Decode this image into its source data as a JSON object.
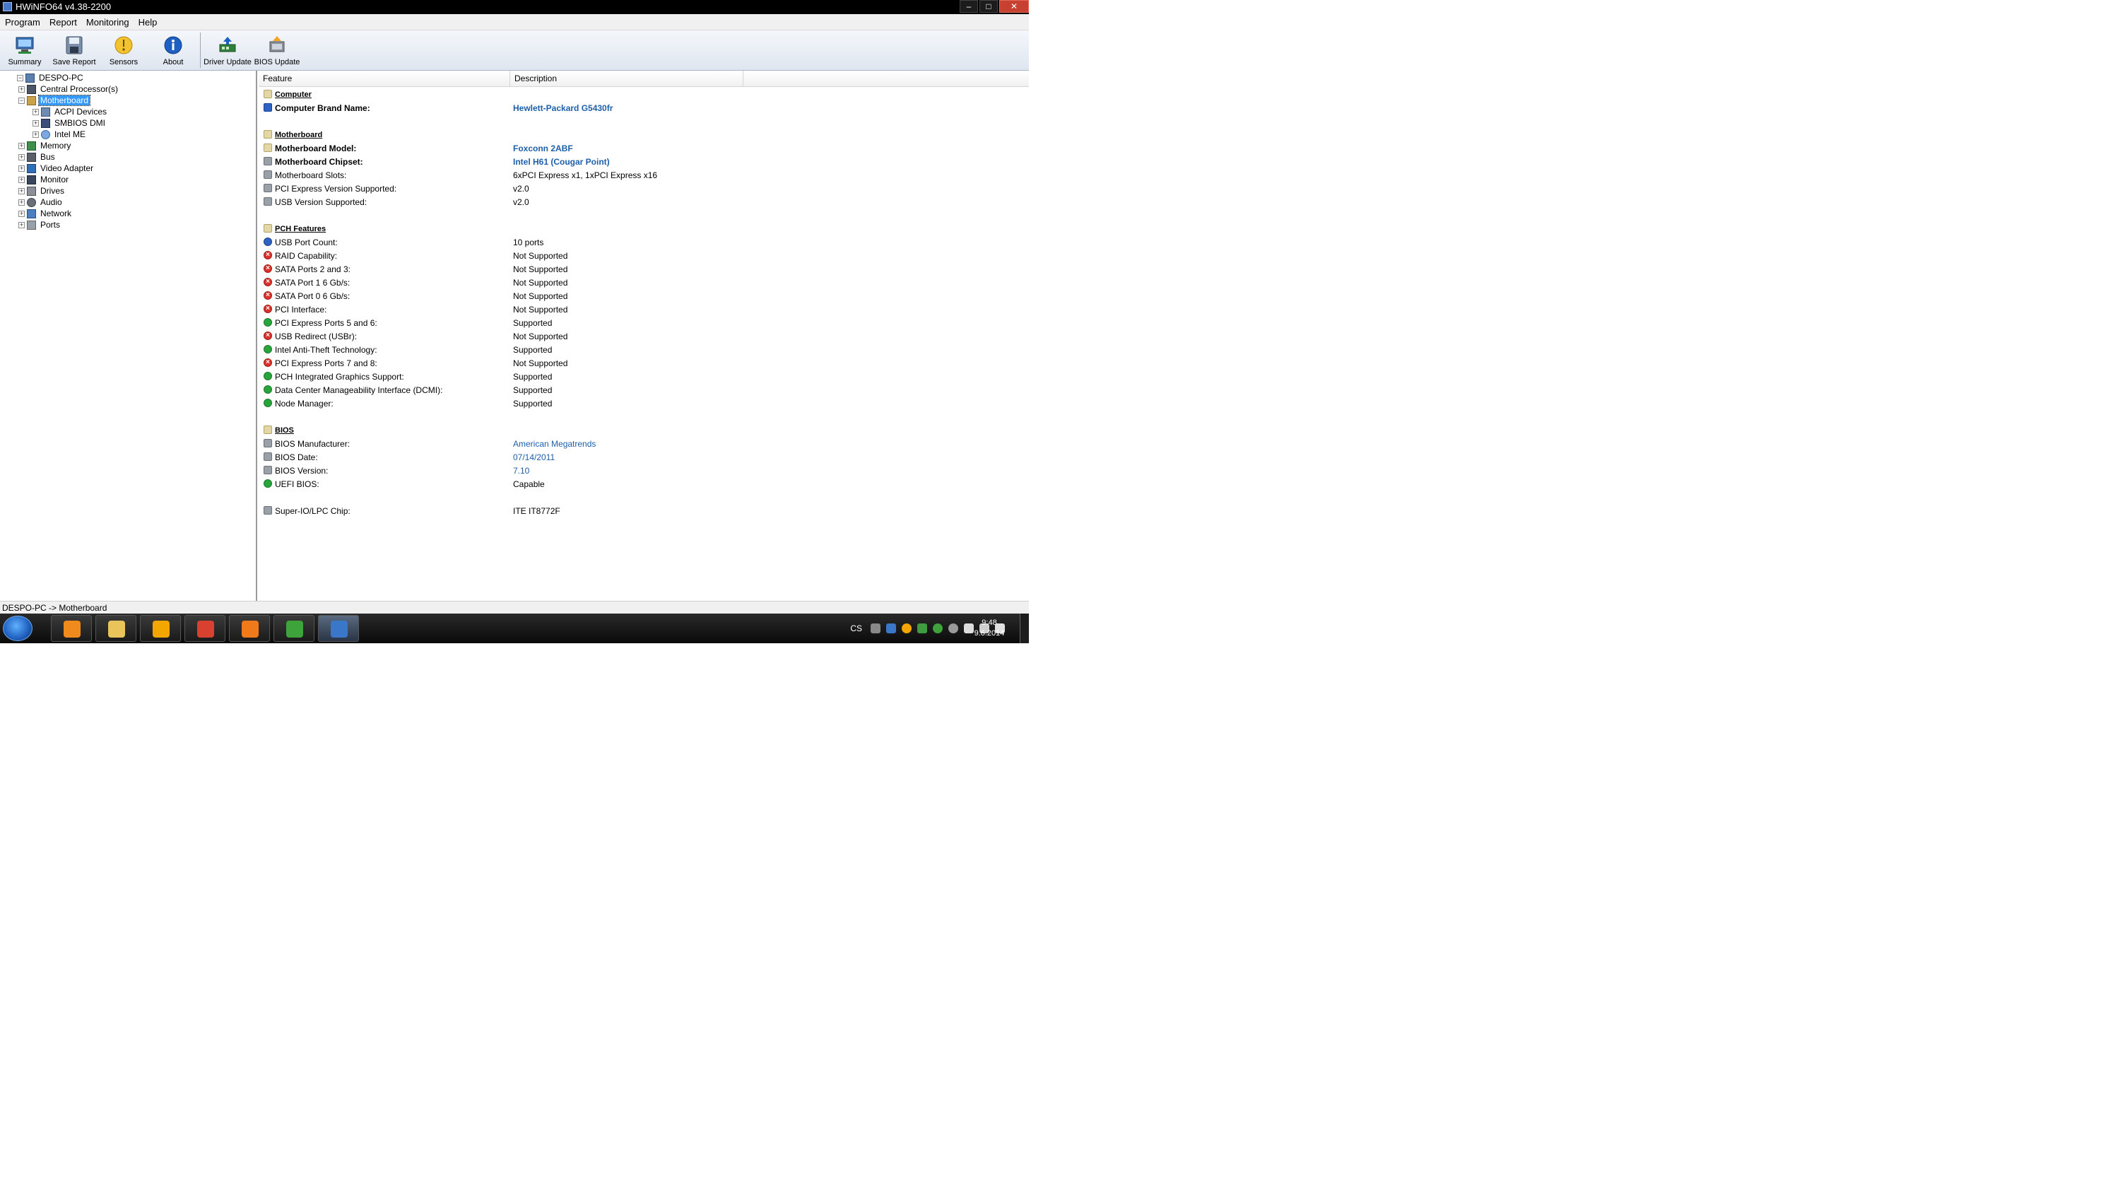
{
  "window": {
    "title": "HWiNFO64 v4.38-2200",
    "buttons": {
      "minimize": "–",
      "maximize": "□",
      "close": "✕"
    }
  },
  "menu": [
    "Program",
    "Report",
    "Monitoring",
    "Help"
  ],
  "toolbar": [
    {
      "label": "Summary",
      "icon": "monitor-chip-icon"
    },
    {
      "label": "Save Report",
      "icon": "floppy-disk-icon"
    },
    {
      "label": "Sensors",
      "icon": "gauge-icon"
    },
    {
      "label": "About",
      "icon": "info-icon"
    },
    {
      "label": "Driver Update",
      "icon": "driver-update-icon"
    },
    {
      "label": "BIOS Update",
      "icon": "bios-update-icon"
    }
  ],
  "tree": {
    "root": "DESPO-PC",
    "items": [
      {
        "label": "Central Processor(s)",
        "level": 1,
        "expander": "+",
        "icon": "cpu-icon"
      },
      {
        "label": "Motherboard",
        "level": 1,
        "expander": "−",
        "icon": "motherboard-icon",
        "selected": true
      },
      {
        "label": "ACPI Devices",
        "level": 2,
        "expander": "+",
        "icon": "acpi-icon"
      },
      {
        "label": "SMBIOS DMI",
        "level": 2,
        "expander": "+",
        "icon": "dmi-icon"
      },
      {
        "label": "Intel ME",
        "level": 2,
        "expander": "+",
        "icon": "intel-me-icon"
      },
      {
        "label": "Memory",
        "level": 1,
        "expander": "+",
        "icon": "memory-icon"
      },
      {
        "label": "Bus",
        "level": 1,
        "expander": "+",
        "icon": "bus-icon"
      },
      {
        "label": "Video Adapter",
        "level": 1,
        "expander": "+",
        "icon": "video-adapter-icon"
      },
      {
        "label": "Monitor",
        "level": 1,
        "expander": "+",
        "icon": "monitor-icon"
      },
      {
        "label": "Drives",
        "level": 1,
        "expander": "+",
        "icon": "drives-icon"
      },
      {
        "label": "Audio",
        "level": 1,
        "expander": "+",
        "icon": "audio-icon"
      },
      {
        "label": "Network",
        "level": 1,
        "expander": "+",
        "icon": "network-icon"
      },
      {
        "label": "Ports",
        "level": 1,
        "expander": "+",
        "icon": "ports-icon"
      }
    ]
  },
  "details": {
    "columns": [
      "Feature",
      "Description"
    ],
    "rows": [
      {
        "type": "section",
        "feature": "Computer"
      },
      {
        "type": "row",
        "bold": true,
        "icon": "computer-icon",
        "feature": "Computer Brand Name:",
        "value": "Hewlett-Packard G5430fr",
        "blue": true
      },
      {
        "type": "gap"
      },
      {
        "type": "section",
        "feature": "Motherboard"
      },
      {
        "type": "row",
        "bold": true,
        "icon": "motherboard-icon",
        "feature": "Motherboard Model:",
        "value": "Foxconn 2ABF",
        "blue": true
      },
      {
        "type": "row",
        "bold": true,
        "icon": "chipset-icon",
        "feature": "Motherboard Chipset:",
        "value": "Intel H61 (Cougar Point)",
        "blue": true
      },
      {
        "type": "row",
        "icon": "slots-icon",
        "feature": "Motherboard Slots:",
        "value": "6xPCI Express x1, 1xPCI Express x16"
      },
      {
        "type": "row",
        "icon": "pcie-icon",
        "feature": "PCI Express Version Supported:",
        "value": "v2.0"
      },
      {
        "type": "row",
        "icon": "usb-icon",
        "feature": "USB Version Supported:",
        "value": "v2.0"
      },
      {
        "type": "gap"
      },
      {
        "type": "section",
        "feature": "PCH Features"
      },
      {
        "type": "row",
        "icon": "info-icon",
        "feature": "USB Port Count:",
        "value": "10 ports"
      },
      {
        "type": "row",
        "icon": "cross-icon",
        "feature": "RAID Capability:",
        "value": "Not Supported"
      },
      {
        "type": "row",
        "icon": "cross-icon",
        "feature": "SATA Ports 2 and 3:",
        "value": "Not Supported"
      },
      {
        "type": "row",
        "icon": "cross-icon",
        "feature": "SATA Port 1 6 Gb/s:",
        "value": "Not Supported"
      },
      {
        "type": "row",
        "icon": "cross-icon",
        "feature": "SATA Port 0 6 Gb/s:",
        "value": "Not Supported"
      },
      {
        "type": "row",
        "icon": "cross-icon",
        "feature": "PCI Interface:",
        "value": "Not Supported"
      },
      {
        "type": "row",
        "icon": "check-icon",
        "feature": "PCI Express Ports 5 and 6:",
        "value": "Supported"
      },
      {
        "type": "row",
        "icon": "cross-icon",
        "feature": "USB Redirect (USBr):",
        "value": "Not Supported"
      },
      {
        "type": "row",
        "icon": "check-icon",
        "feature": "Intel Anti-Theft Technology:",
        "value": "Supported"
      },
      {
        "type": "row",
        "icon": "cross-icon",
        "feature": "PCI Express Ports 7 and 8:",
        "value": "Not Supported"
      },
      {
        "type": "row",
        "icon": "check-icon",
        "feature": "PCH Integrated Graphics Support:",
        "value": "Supported"
      },
      {
        "type": "row",
        "icon": "check-icon",
        "feature": "Data Center Manageability Interface (DCMI):",
        "value": "Supported"
      },
      {
        "type": "row",
        "icon": "check-icon",
        "feature": "Node Manager:",
        "value": "Supported"
      },
      {
        "type": "gap"
      },
      {
        "type": "section",
        "feature": "BIOS"
      },
      {
        "type": "row",
        "icon": "bios-icon",
        "feature": "BIOS Manufacturer:",
        "value": "American Megatrends",
        "blue": true
      },
      {
        "type": "row",
        "icon": "bios-icon",
        "feature": "BIOS Date:",
        "value": "07/14/2011",
        "blue": true
      },
      {
        "type": "row",
        "icon": "bios-icon",
        "feature": "BIOS Version:",
        "value": "7.10",
        "blue": true
      },
      {
        "type": "row",
        "icon": "check-icon",
        "feature": "UEFI BIOS:",
        "value": "Capable"
      },
      {
        "type": "gap"
      },
      {
        "type": "row",
        "icon": "chip-icon",
        "feature": "Super-IO/LPC Chip:",
        "value": "ITE IT8772F"
      }
    ]
  },
  "status": "DESPO-PC -> Motherboard",
  "taskbar": {
    "apps": [
      {
        "name": "media-player-icon",
        "color": "#f08a1c"
      },
      {
        "name": "explorer-icon",
        "color": "#e9c45b"
      },
      {
        "name": "avast-icon",
        "color": "#f3a500"
      },
      {
        "name": "chrome-icon",
        "color": "#d8402f"
      },
      {
        "name": "firefox-icon",
        "color": "#f07a1a"
      },
      {
        "name": "utorrent-icon",
        "color": "#3da33a"
      },
      {
        "name": "hwinfo-icon",
        "color": "#3a77c8"
      }
    ],
    "language": "CS",
    "clock_time": "9:48",
    "clock_date": "9.6.2014",
    "colors": {
      "accent": "#3399ff",
      "link_blue": "#1f5fa8",
      "check_green": "#27a53a",
      "cross_red": "#d8322b"
    }
  }
}
